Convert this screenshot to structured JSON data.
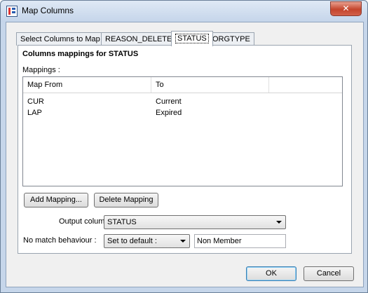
{
  "window": {
    "title": "Map Columns",
    "close_glyph": "✕"
  },
  "tabs": [
    {
      "label": "Select Columns to Map"
    },
    {
      "label": "REASON_DELETED"
    },
    {
      "label": "STATUS"
    },
    {
      "label": "ORGTYPE"
    }
  ],
  "panel": {
    "heading": "Columns mappings for STATUS",
    "mappings_label": "Mappings :",
    "table": {
      "columns": [
        "Map From",
        "To"
      ],
      "rows": [
        {
          "from": "CUR",
          "to": "Current"
        },
        {
          "from": "LAP",
          "to": "Expired"
        }
      ]
    },
    "add_mapping_label": "Add Mapping...",
    "delete_mapping_label": "Delete Mapping"
  },
  "output_column": {
    "label": "Output column :",
    "value": "STATUS"
  },
  "no_match": {
    "label": "No match behaviour :",
    "value": "Set to default :",
    "default_value": "Non Member"
  },
  "footer": {
    "ok_label": "OK",
    "cancel_label": "Cancel"
  },
  "icons": {
    "app": "map-columns-app-icon",
    "close": "close-icon",
    "dropdown": "chevron-down-icon"
  },
  "colors": {
    "title_bar": "#c5d5ea",
    "close_button": "#c4452c",
    "default_button_border": "#3c7fb1"
  }
}
